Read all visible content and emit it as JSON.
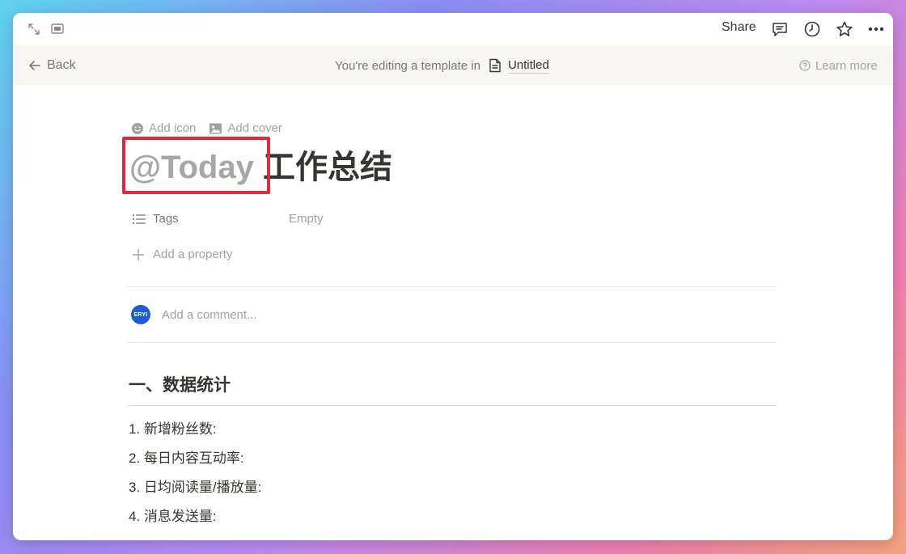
{
  "topbar": {
    "share_label": "Share"
  },
  "editbar": {
    "back_label": "Back",
    "editing_text": "You're editing a template in",
    "page_name": "Untitled",
    "learn_more": "Learn more"
  },
  "page": {
    "add_icon": "Add icon",
    "add_cover": "Add cover",
    "title_mention": "@Today",
    "title_text": "工作总结",
    "properties": [
      {
        "name": "Tags",
        "value": "Empty"
      }
    ],
    "add_property": "Add a property",
    "comment": {
      "avatar_text": "ERYI",
      "placeholder": "Add a comment..."
    },
    "heading": "一、数据统计",
    "list": [
      "1. 新增粉丝数:",
      "2. 每日内容互动率:",
      "3. 日均阅读量/播放量:",
      "4. 消息发送量:"
    ]
  },
  "colors": {
    "highlight_box": "#e0283f",
    "arrow": "#e8344a",
    "avatar_bg": "#1f5cd1",
    "text": "#37352f",
    "muted": "#a3a29e",
    "editbar_bg": "#f7f6f3"
  },
  "icons": {
    "expand": "expand-icon",
    "sidebar": "sidebar-toggle-icon",
    "comments": "comment-icon",
    "history": "clock-icon",
    "favorite": "star-icon",
    "more": "more-icon",
    "back": "arrow-left-icon",
    "page": "page-icon",
    "help": "help-circle-icon",
    "emoji": "smiley-icon",
    "image": "image-icon",
    "list": "list-icon",
    "plus": "plus-icon"
  }
}
